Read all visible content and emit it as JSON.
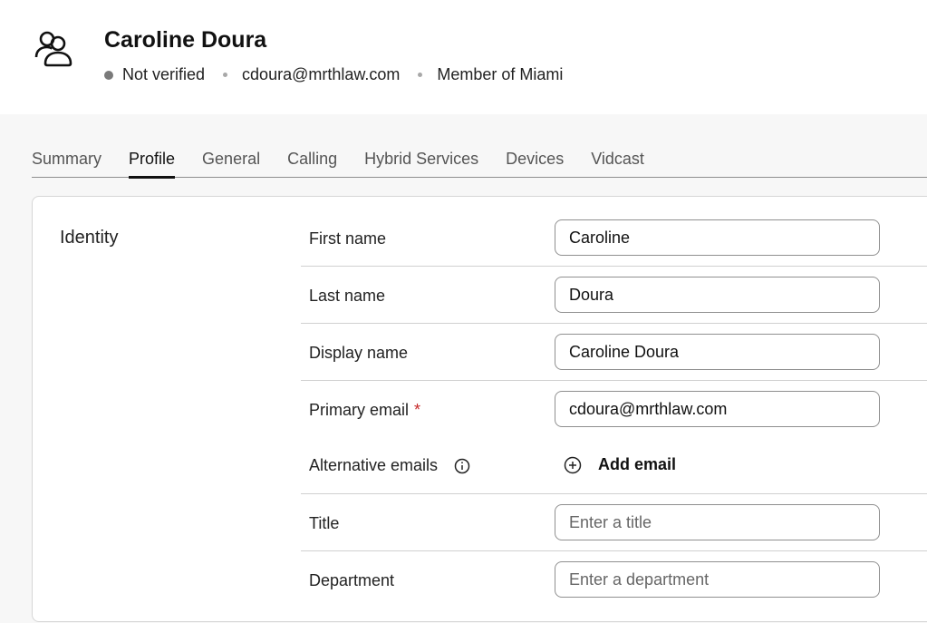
{
  "user": {
    "name": "Caroline Doura",
    "status": "Not verified",
    "email": "cdoura@mrthlaw.com",
    "membership": "Member of Miami"
  },
  "tabs": [
    {
      "label": "Summary",
      "active": false
    },
    {
      "label": "Profile",
      "active": true
    },
    {
      "label": "General",
      "active": false
    },
    {
      "label": "Calling",
      "active": false
    },
    {
      "label": "Hybrid Services",
      "active": false
    },
    {
      "label": "Devices",
      "active": false
    },
    {
      "label": "Vidcast",
      "active": false
    }
  ],
  "identity": {
    "title": "Identity",
    "first_name": {
      "label": "First name",
      "value": "Caroline"
    },
    "last_name": {
      "label": "Last name",
      "value": "Doura"
    },
    "display_name": {
      "label": "Display name",
      "value": "Caroline Doura"
    },
    "primary_email": {
      "label": "Primary email",
      "required_mark": "*",
      "value": "cdoura@mrthlaw.com"
    },
    "alternative_emails": {
      "label": "Alternative emails",
      "add_label": "Add email"
    },
    "job_title": {
      "label": "Title",
      "value": "",
      "placeholder": "Enter a title"
    },
    "department": {
      "label": "Department",
      "value": "",
      "placeholder": "Enter a department"
    }
  },
  "colors": {
    "status_dot": "#7a7a7a",
    "required": "#c62828",
    "active_tab_underline": "#111111"
  },
  "icons": {
    "user": "users-group-icon",
    "info": "info-icon",
    "add": "plus-circle-icon"
  }
}
